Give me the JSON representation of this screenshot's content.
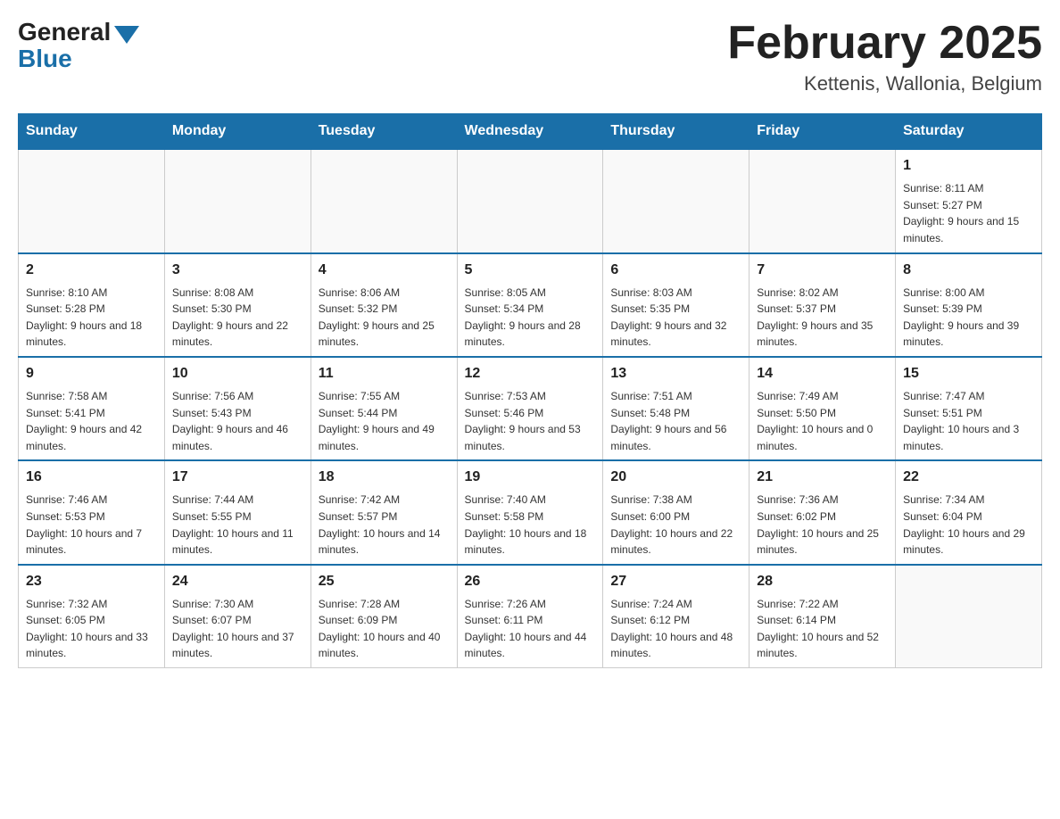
{
  "logo": {
    "general": "General",
    "blue": "Blue"
  },
  "header": {
    "title": "February 2025",
    "subtitle": "Kettenis, Wallonia, Belgium"
  },
  "days_of_week": [
    "Sunday",
    "Monday",
    "Tuesday",
    "Wednesday",
    "Thursday",
    "Friday",
    "Saturday"
  ],
  "weeks": [
    [
      {
        "num": "",
        "info": ""
      },
      {
        "num": "",
        "info": ""
      },
      {
        "num": "",
        "info": ""
      },
      {
        "num": "",
        "info": ""
      },
      {
        "num": "",
        "info": ""
      },
      {
        "num": "",
        "info": ""
      },
      {
        "num": "1",
        "info": "Sunrise: 8:11 AM\nSunset: 5:27 PM\nDaylight: 9 hours and 15 minutes."
      }
    ],
    [
      {
        "num": "2",
        "info": "Sunrise: 8:10 AM\nSunset: 5:28 PM\nDaylight: 9 hours and 18 minutes."
      },
      {
        "num": "3",
        "info": "Sunrise: 8:08 AM\nSunset: 5:30 PM\nDaylight: 9 hours and 22 minutes."
      },
      {
        "num": "4",
        "info": "Sunrise: 8:06 AM\nSunset: 5:32 PM\nDaylight: 9 hours and 25 minutes."
      },
      {
        "num": "5",
        "info": "Sunrise: 8:05 AM\nSunset: 5:34 PM\nDaylight: 9 hours and 28 minutes."
      },
      {
        "num": "6",
        "info": "Sunrise: 8:03 AM\nSunset: 5:35 PM\nDaylight: 9 hours and 32 minutes."
      },
      {
        "num": "7",
        "info": "Sunrise: 8:02 AM\nSunset: 5:37 PM\nDaylight: 9 hours and 35 minutes."
      },
      {
        "num": "8",
        "info": "Sunrise: 8:00 AM\nSunset: 5:39 PM\nDaylight: 9 hours and 39 minutes."
      }
    ],
    [
      {
        "num": "9",
        "info": "Sunrise: 7:58 AM\nSunset: 5:41 PM\nDaylight: 9 hours and 42 minutes."
      },
      {
        "num": "10",
        "info": "Sunrise: 7:56 AM\nSunset: 5:43 PM\nDaylight: 9 hours and 46 minutes."
      },
      {
        "num": "11",
        "info": "Sunrise: 7:55 AM\nSunset: 5:44 PM\nDaylight: 9 hours and 49 minutes."
      },
      {
        "num": "12",
        "info": "Sunrise: 7:53 AM\nSunset: 5:46 PM\nDaylight: 9 hours and 53 minutes."
      },
      {
        "num": "13",
        "info": "Sunrise: 7:51 AM\nSunset: 5:48 PM\nDaylight: 9 hours and 56 minutes."
      },
      {
        "num": "14",
        "info": "Sunrise: 7:49 AM\nSunset: 5:50 PM\nDaylight: 10 hours and 0 minutes."
      },
      {
        "num": "15",
        "info": "Sunrise: 7:47 AM\nSunset: 5:51 PM\nDaylight: 10 hours and 3 minutes."
      }
    ],
    [
      {
        "num": "16",
        "info": "Sunrise: 7:46 AM\nSunset: 5:53 PM\nDaylight: 10 hours and 7 minutes."
      },
      {
        "num": "17",
        "info": "Sunrise: 7:44 AM\nSunset: 5:55 PM\nDaylight: 10 hours and 11 minutes."
      },
      {
        "num": "18",
        "info": "Sunrise: 7:42 AM\nSunset: 5:57 PM\nDaylight: 10 hours and 14 minutes."
      },
      {
        "num": "19",
        "info": "Sunrise: 7:40 AM\nSunset: 5:58 PM\nDaylight: 10 hours and 18 minutes."
      },
      {
        "num": "20",
        "info": "Sunrise: 7:38 AM\nSunset: 6:00 PM\nDaylight: 10 hours and 22 minutes."
      },
      {
        "num": "21",
        "info": "Sunrise: 7:36 AM\nSunset: 6:02 PM\nDaylight: 10 hours and 25 minutes."
      },
      {
        "num": "22",
        "info": "Sunrise: 7:34 AM\nSunset: 6:04 PM\nDaylight: 10 hours and 29 minutes."
      }
    ],
    [
      {
        "num": "23",
        "info": "Sunrise: 7:32 AM\nSunset: 6:05 PM\nDaylight: 10 hours and 33 minutes."
      },
      {
        "num": "24",
        "info": "Sunrise: 7:30 AM\nSunset: 6:07 PM\nDaylight: 10 hours and 37 minutes."
      },
      {
        "num": "25",
        "info": "Sunrise: 7:28 AM\nSunset: 6:09 PM\nDaylight: 10 hours and 40 minutes."
      },
      {
        "num": "26",
        "info": "Sunrise: 7:26 AM\nSunset: 6:11 PM\nDaylight: 10 hours and 44 minutes."
      },
      {
        "num": "27",
        "info": "Sunrise: 7:24 AM\nSunset: 6:12 PM\nDaylight: 10 hours and 48 minutes."
      },
      {
        "num": "28",
        "info": "Sunrise: 7:22 AM\nSunset: 6:14 PM\nDaylight: 10 hours and 52 minutes."
      },
      {
        "num": "",
        "info": ""
      }
    ]
  ]
}
